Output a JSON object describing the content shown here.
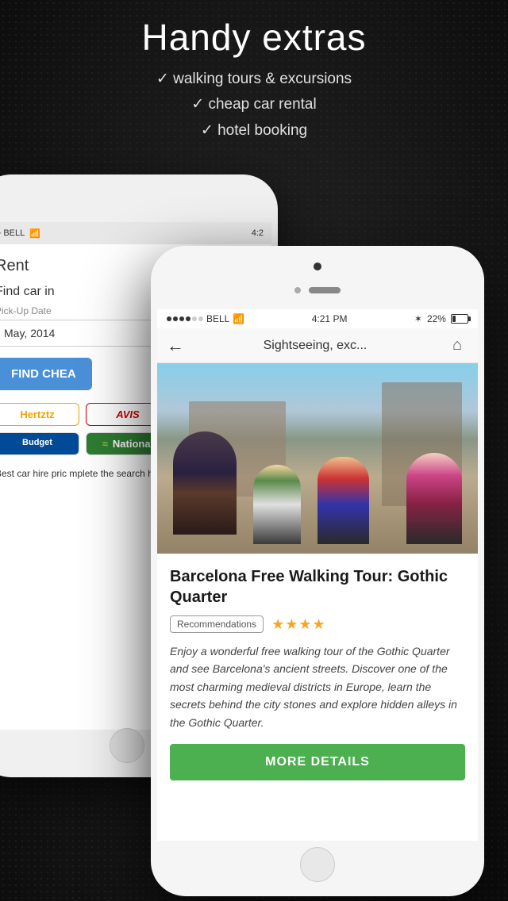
{
  "page": {
    "background": "#1a1a1a"
  },
  "header": {
    "title": "Handy extras",
    "checklist": [
      "✓ walking tours & excursions",
      "✓ cheap car rental",
      "✓ hotel booking"
    ]
  },
  "phone_back": {
    "statusbar": {
      "carrier": "○○ BELL",
      "wifi": "WiFi",
      "time": "4:2"
    },
    "content": {
      "rent_label": "Rent",
      "find_car_label": "Find car in",
      "pickup_date_label": "Pick-Up Date",
      "pickup_date_value": "May, 2014",
      "find_button": "FIND CHEA",
      "brands": [
        {
          "name": "Hertz",
          "style": "hertz"
        },
        {
          "name": "AVIS",
          "style": "avis"
        },
        {
          "name": "Budget",
          "style": "budget"
        },
        {
          "name": "National",
          "style": "national"
        }
      ],
      "description": "Best car hire pric mplete the search heap car hire at o world"
    }
  },
  "phone_front": {
    "statusbar": {
      "dots_filled": 4,
      "dots_empty": 2,
      "carrier": "BELL",
      "wifi": "WiFi",
      "time": "4:21 PM",
      "bluetooth": "BT",
      "battery": "22%"
    },
    "navbar": {
      "back_icon": "←",
      "title": "Sightseeing, exc...",
      "home_icon": "⌂"
    },
    "tour": {
      "title": "Barcelona Free Walking Tour: Gothic Quarter",
      "tag": "Recommendations",
      "stars": "★★★★",
      "description": "Enjoy a wonderful free walking tour of the Gothic Quarter and see Barcelona's ancient streets. Discover one of the most charming medieval districts in Europe, learn the secrets behind the city stones and explore hidden alleys in the Gothic Quarter.",
      "more_button": "MORE DETAILS"
    }
  }
}
